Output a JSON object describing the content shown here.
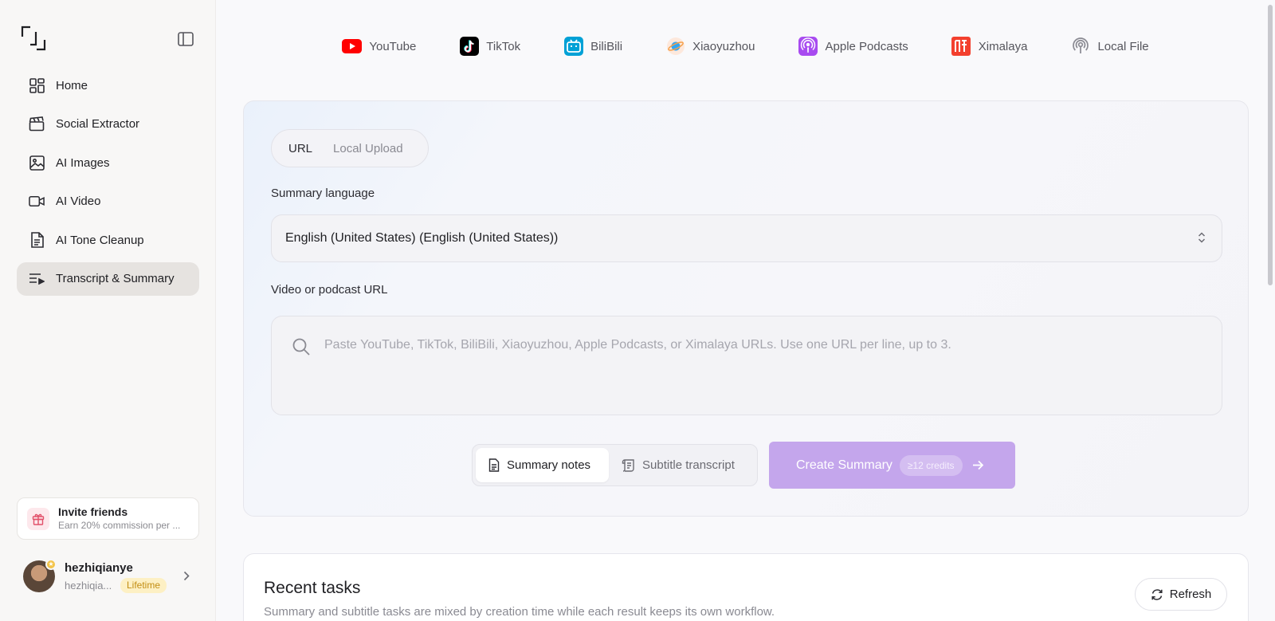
{
  "sidebar": {
    "logo_icon": "bracket-logo-icon",
    "items": [
      {
        "label": "Home",
        "icon": "grid-icon"
      },
      {
        "label": "Social Extractor",
        "icon": "clapperboard-icon"
      },
      {
        "label": "AI Images",
        "icon": "image-icon"
      },
      {
        "label": "AI Video",
        "icon": "video-camera-icon"
      },
      {
        "label": "AI Tone Cleanup",
        "icon": "document-icon"
      },
      {
        "label": "Transcript & Summary",
        "icon": "list-play-icon",
        "active": true
      }
    ],
    "invite": {
      "title": "Invite friends",
      "subtitle": "Earn 20% commission per ..."
    },
    "user": {
      "name": "hezhiqianye",
      "handle": "hezhiqia...",
      "plan": "Lifetime"
    }
  },
  "platforms": [
    {
      "label": "YouTube",
      "icon": "youtube-icon",
      "color": "#ff0000"
    },
    {
      "label": "TikTok",
      "icon": "tiktok-icon",
      "color": "#000000"
    },
    {
      "label": "BiliBili",
      "icon": "bilibili-icon",
      "color": "#00a1d6"
    },
    {
      "label": "Xiaoyuzhou",
      "icon": "xiaoyuzhou-icon",
      "color": "#2fa6f5"
    },
    {
      "label": "Apple Podcasts",
      "icon": "apple-podcasts-icon",
      "color": "#a84bf0"
    },
    {
      "label": "Ximalaya",
      "icon": "ximalaya-icon",
      "color": "#f3402e"
    },
    {
      "label": "Local File",
      "icon": "podcast-icon",
      "color": "#8a8a92"
    }
  ],
  "form": {
    "source_tabs": [
      "URL",
      "Local Upload"
    ],
    "summary_language_label": "Summary language",
    "summary_language_value": "English (United States) (English (United States))",
    "url_label": "Video or podcast URL",
    "url_placeholder": "Paste YouTube, TikTok, BiliBili, Xiaoyuzhou, Apple Podcasts, or Ximalaya URLs. Use one URL per line, up to 3.",
    "output_types": [
      "Summary notes",
      "Subtitle transcript"
    ],
    "create_button": "Create Summary",
    "credits_badge": "≥12 credits",
    "accent_color": "#c4a6ec"
  },
  "recent": {
    "title": "Recent tasks",
    "subtitle": "Summary and subtitle tasks are mixed by creation time while each result keeps its own workflow.",
    "refresh_label": "Refresh"
  }
}
